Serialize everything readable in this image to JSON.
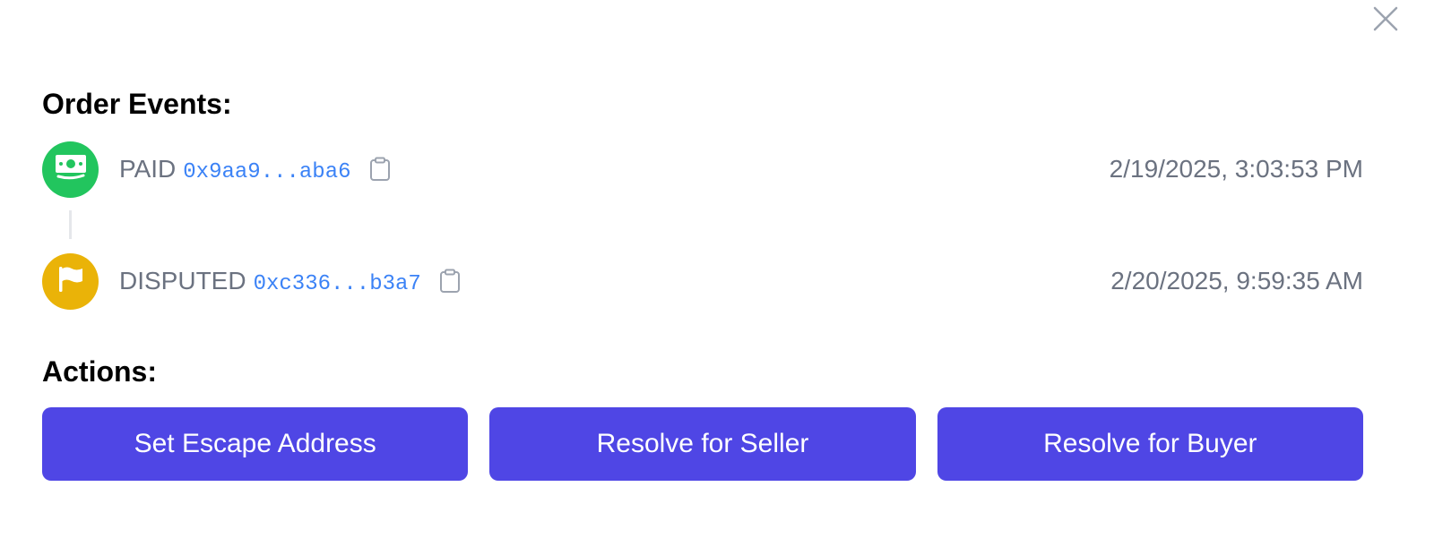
{
  "dialog": {
    "close_icon": "close-icon"
  },
  "events": {
    "title": "Order Events:",
    "items": [
      {
        "status": "PAID",
        "tx_hash": "0x9aa9...aba6",
        "timestamp": "2/19/2025, 3:03:53 PM",
        "icon": "money-bill-icon",
        "color": "#22c55e"
      },
      {
        "status": "DISPUTED",
        "tx_hash": "0xc336...b3a7",
        "timestamp": "2/20/2025, 9:59:35 AM",
        "icon": "flag-icon",
        "color": "#eab308"
      }
    ],
    "copy_icon": "clipboard-icon",
    "hash_color": "#3b82f6"
  },
  "actions": {
    "title": "Actions:",
    "buttons": [
      {
        "label": "Set Escape Address"
      },
      {
        "label": "Resolve for Seller"
      },
      {
        "label": "Resolve for Buyer"
      }
    ],
    "button_color": "#4f46e5"
  }
}
